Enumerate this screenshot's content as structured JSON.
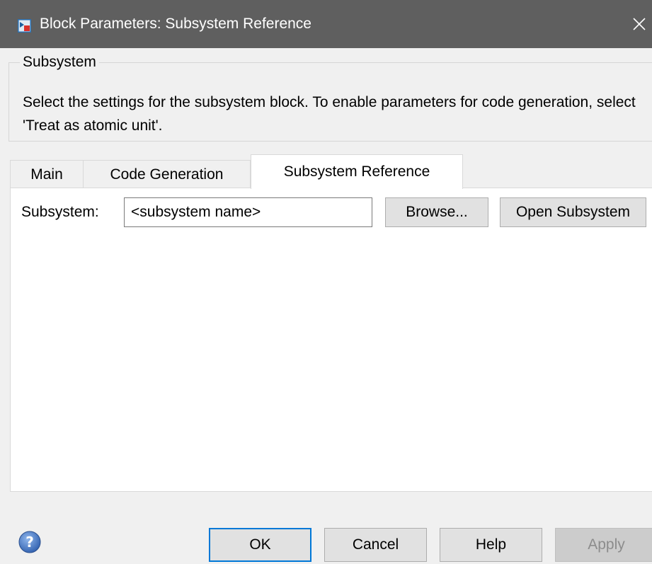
{
  "window": {
    "title": "Block Parameters: Subsystem Reference",
    "app_icon": "simulink-block-icon",
    "close_icon": "close-icon"
  },
  "group": {
    "title": "Subsystem",
    "description": "Select the settings for the subsystem block. To enable parameters for code generation, select 'Treat as atomic unit'."
  },
  "tabs": [
    {
      "label": "Main",
      "active": false
    },
    {
      "label": "Code Generation",
      "active": false
    },
    {
      "label": "Subsystem Reference",
      "active": true
    }
  ],
  "subsystem_field": {
    "label": "Subsystem:",
    "value": "<subsystem name>",
    "browse_label": "Browse...",
    "open_label": "Open Subsystem"
  },
  "footer": {
    "help_icon": "help-question-icon",
    "ok_label": "OK",
    "cancel_label": "Cancel",
    "help_label": "Help",
    "apply_label": "Apply"
  },
  "colors": {
    "titlebar": "#5f5f5f",
    "dialog_bg": "#f0f0f0",
    "focus_border": "#0078d7",
    "disabled_text": "#8c8c8c"
  }
}
